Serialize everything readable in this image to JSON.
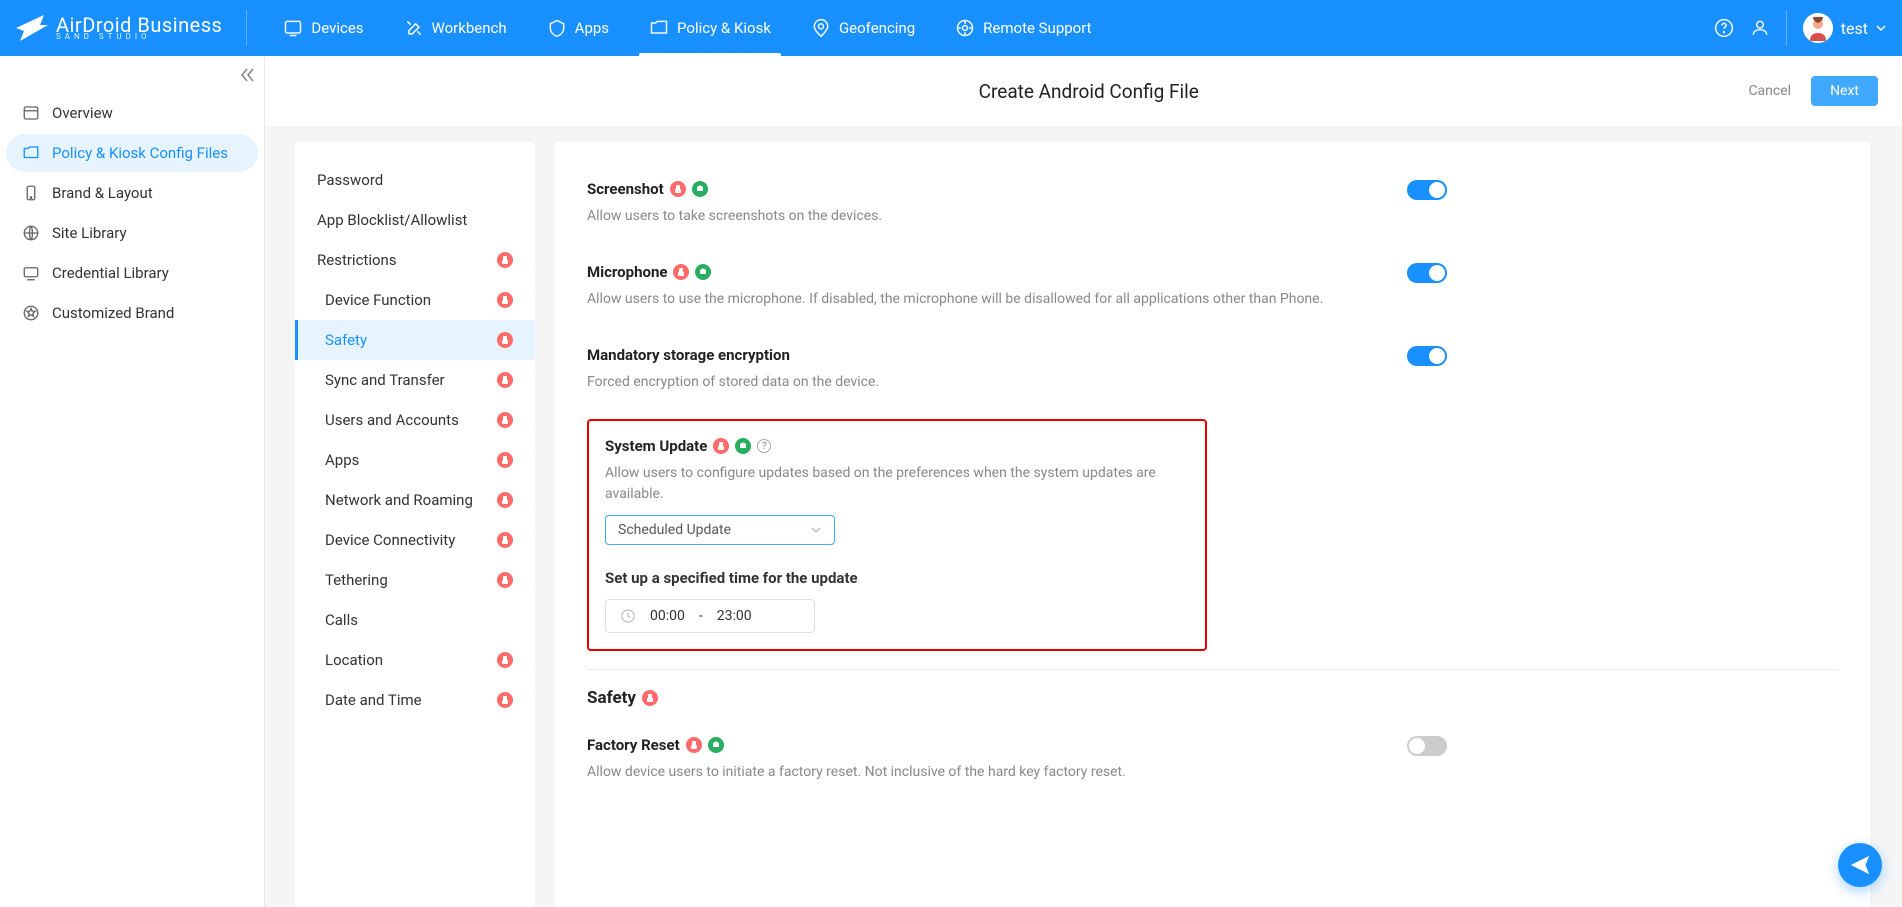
{
  "brand": {
    "name": "AirDroid Business",
    "sub": "SAND STUDIO"
  },
  "topnav": {
    "items": [
      {
        "label": "Devices"
      },
      {
        "label": "Workbench"
      },
      {
        "label": "Apps"
      },
      {
        "label": "Policy & Kiosk"
      },
      {
        "label": "Geofencing"
      },
      {
        "label": "Remote Support"
      }
    ],
    "user": "test"
  },
  "sidebar": {
    "items": [
      {
        "label": "Overview"
      },
      {
        "label": "Policy & Kiosk Config Files"
      },
      {
        "label": "Brand & Layout"
      },
      {
        "label": "Site Library"
      },
      {
        "label": "Credential Library"
      },
      {
        "label": "Customized Brand"
      }
    ]
  },
  "page": {
    "title": "Create Android Config File",
    "cancel": "Cancel",
    "next": "Next"
  },
  "innerSidebar": {
    "items": [
      {
        "label": "Password"
      },
      {
        "label": "App Blocklist/Allowlist"
      },
      {
        "label": "Restrictions"
      },
      {
        "label": "Device Function"
      },
      {
        "label": "Safety"
      },
      {
        "label": "Sync and Transfer"
      },
      {
        "label": "Users and Accounts"
      },
      {
        "label": "Apps"
      },
      {
        "label": "Network and Roaming"
      },
      {
        "label": "Device Connectivity"
      },
      {
        "label": "Tethering"
      },
      {
        "label": "Calls"
      },
      {
        "label": "Location"
      },
      {
        "label": "Date and Time"
      }
    ]
  },
  "settings": {
    "screenshot": {
      "title": "Screenshot",
      "desc": "Allow users to take screenshots on the devices."
    },
    "microphone": {
      "title": "Microphone",
      "desc": "Allow users to use the microphone. If disabled, the microphone will be disallowed for all applications other than Phone."
    },
    "encryption": {
      "title": "Mandatory storage encryption",
      "desc": "Forced encryption of stored data on the device."
    },
    "systemUpdate": {
      "title": "System Update",
      "desc": "Allow users to configure updates based on the preferences when the system updates are available.",
      "selected": "Scheduled Update",
      "subTitle": "Set up a specified time for the update",
      "timeStart": "00:00",
      "timeSep": "-",
      "timeEnd": "23:00"
    },
    "safetyHeading": "Safety",
    "factoryReset": {
      "title": "Factory Reset",
      "desc": "Allow device users to initiate a factory reset. Not inclusive of the hard key factory reset."
    }
  }
}
